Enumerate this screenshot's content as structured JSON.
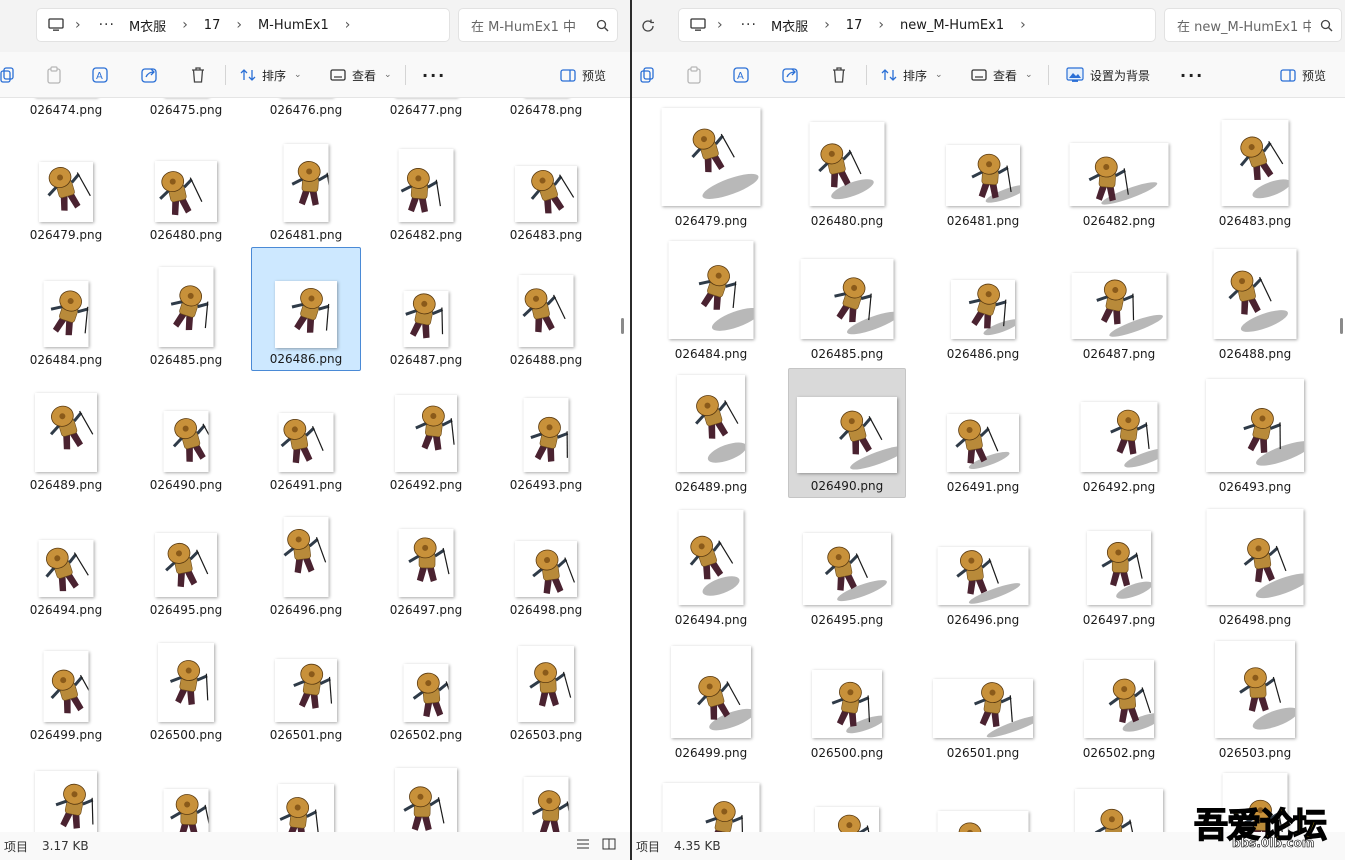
{
  "left": {
    "breadcrumb": {
      "parent": "M衣服",
      "folder": "17",
      "current": "M-HumEx1"
    },
    "search_placeholder": "在 M-HumEx1 中",
    "toolbar": {
      "sort": "排序",
      "view": "查看",
      "preview": "预览"
    },
    "status": {
      "count": "项目",
      "size": "3.17 KB"
    },
    "rows": [
      [
        "026474.png",
        "026475.png",
        "026476.png",
        "026477.png",
        "026478.png"
      ],
      [
        "026479.png",
        "026480.png",
        "026481.png",
        "026482.png",
        "026483.png"
      ],
      [
        "026484.png",
        "026485.png",
        "026486.png",
        "026487.png",
        "026488.png"
      ],
      [
        "026489.png",
        "026490.png",
        "026491.png",
        "026492.png",
        "026493.png"
      ],
      [
        "026494.png",
        "026495.png",
        "026496.png",
        "026497.png",
        "026498.png"
      ],
      [
        "026499.png",
        "026500.png",
        "026501.png",
        "026502.png",
        "026503.png"
      ],
      [
        "",
        "",
        "",
        "",
        ""
      ]
    ],
    "selected": "026486.png"
  },
  "right": {
    "breadcrumb": {
      "parent": "M衣服",
      "folder": "17",
      "current": "new_M-HumEx1"
    },
    "search_placeholder": "在 new_M-HumEx1 中",
    "toolbar": {
      "sort": "排序",
      "view": "查看",
      "set_background": "设置为背景",
      "preview": "预览"
    },
    "status": {
      "count": "项目",
      "size": "4.35 KB"
    },
    "rows": [
      [
        "026479.png",
        "026480.png",
        "026481.png",
        "026482.png",
        "026483.png"
      ],
      [
        "026484.png",
        "026485.png",
        "026486.png",
        "026487.png",
        "026488.png"
      ],
      [
        "026489.png",
        "026490.png",
        "026491.png",
        "026492.png",
        "026493.png"
      ],
      [
        "026494.png",
        "026495.png",
        "026496.png",
        "026497.png",
        "026498.png"
      ],
      [
        "026499.png",
        "026500.png",
        "026501.png",
        "026502.png",
        "026503.png"
      ],
      [
        "",
        "",
        "",
        "",
        ""
      ]
    ],
    "selected": "026490.png"
  },
  "watermark": {
    "main": "吾爱论坛",
    "sub": "bbs.0lb.com"
  },
  "colors": {
    "hat": "#c8913a",
    "robe": "#4a2230",
    "vest": "#b88a3a",
    "skin": "#d9b48a",
    "selection_blue": "#cde8ff"
  }
}
